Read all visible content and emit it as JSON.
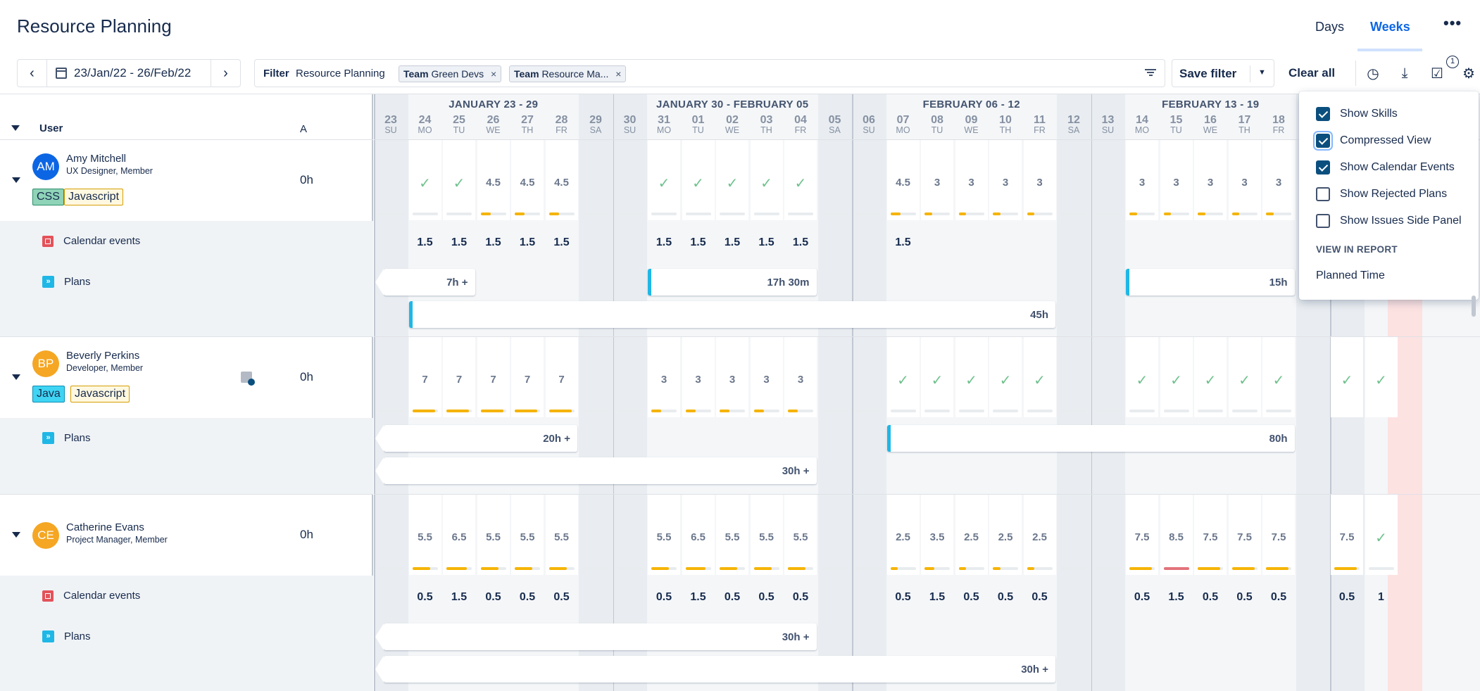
{
  "header": {
    "title": "Resource Planning",
    "tabs": [
      {
        "label": "Days"
      },
      {
        "label": "Weeks"
      }
    ],
    "more_label": "•••"
  },
  "toolbar": {
    "date_range": "23/Jan/22 - 26/Feb/22",
    "filter_label": "Filter",
    "filter_value": "Resource Planning",
    "chips": [
      {
        "key": "Team",
        "value": "Green Devs"
      },
      {
        "key": "Team",
        "value": "Resource Ma..."
      }
    ],
    "save_filter": "Save filter",
    "clear_all": "Clear all",
    "icons": [
      "history-icon",
      "download-icon",
      "approval-icon",
      "gear-icon"
    ],
    "badge_count": "1"
  },
  "grid_header": {
    "user_col": "User",
    "a_col": "A",
    "weeks": [
      "JANUARY 23 - 29",
      "JANUARY 30 - FEBRUARY 05",
      "FEBRUARY 06 - 12",
      "FEBRUARY 13 - 19"
    ],
    "days": [
      {
        "n": "23",
        "d": "SU"
      },
      {
        "n": "24",
        "d": "MO"
      },
      {
        "n": "25",
        "d": "TU"
      },
      {
        "n": "26",
        "d": "WE"
      },
      {
        "n": "27",
        "d": "TH"
      },
      {
        "n": "28",
        "d": "FR"
      },
      {
        "n": "29",
        "d": "SA"
      },
      {
        "n": "30",
        "d": "SU"
      },
      {
        "n": "31",
        "d": "MO"
      },
      {
        "n": "01",
        "d": "TU"
      },
      {
        "n": "02",
        "d": "WE"
      },
      {
        "n": "03",
        "d": "TH"
      },
      {
        "n": "04",
        "d": "FR"
      },
      {
        "n": "05",
        "d": "SA"
      },
      {
        "n": "06",
        "d": "SU"
      },
      {
        "n": "07",
        "d": "MO"
      },
      {
        "n": "08",
        "d": "TU"
      },
      {
        "n": "09",
        "d": "WE"
      },
      {
        "n": "10",
        "d": "TH"
      },
      {
        "n": "11",
        "d": "FR"
      },
      {
        "n": "12",
        "d": "SA"
      },
      {
        "n": "13",
        "d": "SU"
      },
      {
        "n": "14",
        "d": "MO"
      },
      {
        "n": "15",
        "d": "TU"
      },
      {
        "n": "16",
        "d": "WE"
      },
      {
        "n": "17",
        "d": "TH"
      },
      {
        "n": "18",
        "d": "FR"
      }
    ]
  },
  "users": [
    {
      "initials": "AM",
      "name": "Amy Mitchell",
      "role": "UX Designer, Member",
      "hours": "0h",
      "avatar_color": "#0c66e4",
      "skills": [
        {
          "label": "CSS",
          "style": "green"
        },
        {
          "label": "Javascript",
          "style": "yellow"
        }
      ],
      "cells": [
        "",
        "✓",
        "✓",
        "4.5",
        "4.5",
        "4.5",
        "",
        "",
        "✓",
        "✓",
        "✓",
        "✓",
        "✓",
        "",
        "",
        "4.5",
        "3",
        "3",
        "3",
        "3",
        "",
        "",
        "3",
        "3",
        "3",
        "3",
        "3"
      ],
      "util": [
        0,
        0,
        0,
        0.4,
        0.4,
        0.4,
        0,
        0,
        0,
        0,
        0,
        0,
        0,
        0,
        0,
        0.4,
        0.3,
        0.3,
        0.3,
        0.3,
        0,
        0,
        0.3,
        0.3,
        0.3,
        0.3,
        0.3
      ],
      "calendar_label": "Calendar events",
      "calendar": [
        "",
        "1.5",
        "1.5",
        "1.5",
        "1.5",
        "1.5",
        "",
        "",
        "1.5",
        "1.5",
        "1.5",
        "1.5",
        "1.5",
        "",
        "",
        "1.5",
        "",
        "",
        "",
        "",
        "",
        "",
        "",
        "",
        "",
        "",
        ""
      ],
      "plans_label": "Plans",
      "plans": [
        {
          "label": "7h +",
          "open": true,
          "from": 0,
          "to": 3
        },
        {
          "label": "17h 30m",
          "open": false,
          "from": 8,
          "to": 13
        },
        {
          "label": "15h",
          "open": false,
          "from": 22,
          "to": 27
        },
        {
          "label": "45h",
          "open": false,
          "from": 1,
          "to": 20,
          "lane": 1
        }
      ]
    },
    {
      "initials": "BP",
      "name": "Beverly Perkins",
      "role": "Developer, Member",
      "hours": "0h",
      "avatar_color": "#f5a623",
      "skills": [
        {
          "label": "Java",
          "style": "cyan"
        },
        {
          "label": "Javascript",
          "style": "yellow"
        }
      ],
      "cells": [
        "",
        "7",
        "7",
        "7",
        "7",
        "7",
        "",
        "",
        "3",
        "3",
        "3",
        "3",
        "3",
        "",
        "",
        "✓",
        "✓",
        "✓",
        "✓",
        "✓",
        "",
        "",
        "✓",
        "✓",
        "✓",
        "✓",
        "✓"
      ],
      "util": [
        0,
        0.9,
        0.9,
        0.9,
        0.9,
        0.9,
        0,
        0,
        0.4,
        0.4,
        0.4,
        0.4,
        0.4,
        0,
        0,
        0,
        0,
        0,
        0,
        0,
        0,
        0,
        0,
        0,
        0,
        0,
        0
      ],
      "plans_label": "Plans",
      "plans": [
        {
          "label": "20h +",
          "open": true,
          "from": 0,
          "to": 6
        },
        {
          "label": "80h",
          "open": false,
          "from": 15,
          "to": 27
        },
        {
          "label": "30h +",
          "open": true,
          "from": 0,
          "to": 13,
          "lane": 1
        }
      ]
    },
    {
      "initials": "CE",
      "name": "Catherine Evans",
      "role": "Project Manager, Member",
      "hours": "0h",
      "avatar_color": "#f5a623",
      "skills": [],
      "cells": [
        "",
        "5.5",
        "6.5",
        "5.5",
        "5.5",
        "5.5",
        "",
        "",
        "5.5",
        "6.5",
        "5.5",
        "5.5",
        "5.5",
        "",
        "",
        "2.5",
        "3.5",
        "2.5",
        "2.5",
        "2.5",
        "",
        "",
        "7.5",
        "8.5",
        "7.5",
        "7.5",
        "7.5"
      ],
      "util": [
        0,
        0.7,
        0.8,
        0.7,
        0.7,
        0.7,
        0,
        0,
        0.7,
        0.8,
        0.7,
        0.7,
        0.7,
        0,
        0,
        0.3,
        0.4,
        0.3,
        0.3,
        0.3,
        0,
        0,
        0.9,
        1.1,
        0.9,
        0.9,
        0.9
      ],
      "calendar_label": "Calendar events",
      "calendar": [
        "",
        "0.5",
        "1.5",
        "0.5",
        "0.5",
        "0.5",
        "",
        "",
        "0.5",
        "1.5",
        "0.5",
        "0.5",
        "0.5",
        "",
        "",
        "0.5",
        "1.5",
        "0.5",
        "0.5",
        "0.5",
        "",
        "",
        "0.5",
        "1.5",
        "0.5",
        "0.5",
        "0.5"
      ],
      "plans_label": "Plans",
      "plans": [
        {
          "label": "30h +",
          "open": true,
          "from": 0,
          "to": 13
        },
        {
          "label": "30h +",
          "open": true,
          "from": 0,
          "to": 20,
          "lane": 1
        }
      ]
    }
  ],
  "extra_right": {
    "bp_checks": [
      "✓",
      "✓"
    ],
    "ce_values": [
      "7.5",
      "✓"
    ],
    "ce_calendar": [
      "0.5",
      "1"
    ]
  },
  "settings_menu": {
    "options": [
      {
        "label": "Show Skills",
        "checked": true
      },
      {
        "label": "Compressed View",
        "checked": true
      },
      {
        "label": "Show Calendar Events",
        "checked": true
      },
      {
        "label": "Show Rejected Plans",
        "checked": false
      },
      {
        "label": "Show Issues Side Panel",
        "checked": false
      }
    ],
    "section_title": "VIEW IN REPORT",
    "item": "Planned Time"
  },
  "colors": {
    "accent": "#0c66e4",
    "weekend_bg": "#e9edf1",
    "util_fill": "#f5b400",
    "util_over": "#e2737b",
    "check": "#6fc18d",
    "plan_marker": "#1fb7e6",
    "holiday": "#fde2e2"
  }
}
